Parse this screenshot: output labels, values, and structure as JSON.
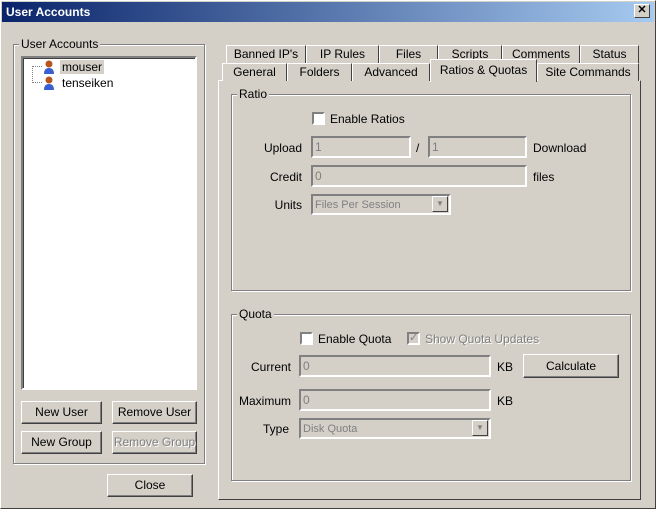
{
  "window": {
    "title": "User Accounts",
    "close_glyph": "✕"
  },
  "left": {
    "group_label": "User Accounts",
    "users": [
      {
        "name": "mouser",
        "selected": true
      },
      {
        "name": "tenseiken",
        "selected": false
      }
    ],
    "buttons": {
      "new_user": "New User",
      "remove_user": "Remove User",
      "new_group": "New Group",
      "remove_group": "Remove Group"
    }
  },
  "close_button": "Close",
  "tabs": {
    "row1": [
      "Banned IP's",
      "IP Rules",
      "Files",
      "Scripts",
      "Comments",
      "Status"
    ],
    "row2": [
      "General",
      "Folders",
      "Advanced",
      "Ratios & Quotas",
      "Site Commands"
    ],
    "selected": "Ratios & Quotas"
  },
  "ratio": {
    "group_label": "Ratio",
    "enable_label": "Enable Ratios",
    "enabled": false,
    "upload_label": "Upload",
    "upload_value": "1",
    "slash": "/",
    "download_value": "1",
    "download_label": "Download",
    "credit_label": "Credit",
    "credit_value": "0",
    "credit_unit": "files",
    "units_label": "Units",
    "units_value": "Files Per Session"
  },
  "quota": {
    "group_label": "Quota",
    "enable_label": "Enable Quota",
    "enabled": false,
    "show_updates_label": "Show Quota Updates",
    "show_updates": true,
    "current_label": "Current",
    "current_value": "0",
    "current_unit": "KB",
    "calculate": "Calculate",
    "maximum_label": "Maximum",
    "maximum_value": "0",
    "maximum_unit": "KB",
    "type_label": "Type",
    "type_value": "Disk Quota"
  }
}
